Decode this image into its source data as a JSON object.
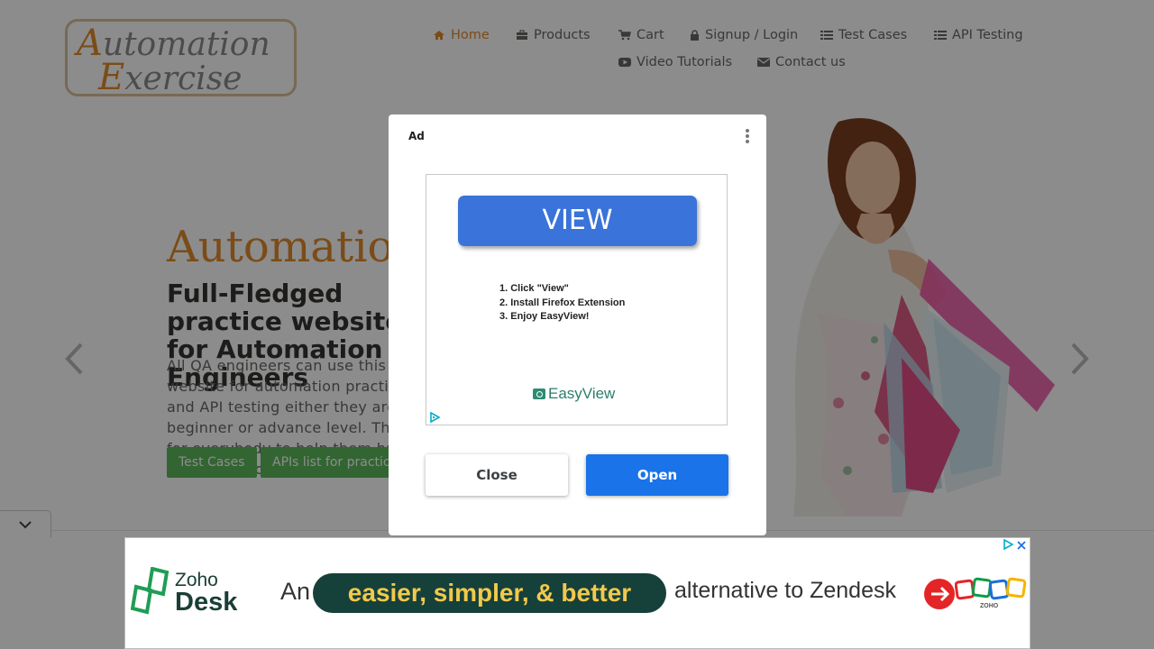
{
  "logo": {
    "line1_cap": "A",
    "line1_rest": "utomation",
    "line2_cap": "E",
    "line2_rest": "xercise"
  },
  "nav": [
    {
      "label": "Home",
      "icon": "home-icon",
      "active": true
    },
    {
      "label": "Products",
      "icon": "briefcase-icon"
    },
    {
      "label": "Cart",
      "icon": "cart-icon"
    },
    {
      "label": "Signup / Login",
      "icon": "lock-icon"
    },
    {
      "label": "Test Cases",
      "icon": "list-icon"
    },
    {
      "label": "API Testing",
      "icon": "list-icon"
    },
    {
      "label": "Video Tutorials",
      "icon": "youtube-icon"
    },
    {
      "label": "Contact us",
      "icon": "envelope-icon"
    }
  ],
  "hero": {
    "title": "Automation",
    "subtitle": "Full-Fledged practice website for Automation Engineers",
    "description": "All QA engineers can use this website for automation practice and API testing either they are at beginner or advance level. This is for everybody to help them brush up their automation skills.",
    "btn_test_cases": "Test Cases",
    "btn_apis": "APIs list for practice"
  },
  "ad_modal": {
    "ad_label": "Ad",
    "view_label": "VIEW",
    "steps": [
      "1. Click \"View\"",
      "2. Install Firefox Extension",
      "3. Enjoy EasyView!"
    ],
    "brand": "EasyView",
    "close_label": "Close",
    "open_label": "Open"
  },
  "banner": {
    "brand_line1": "Zoho",
    "brand_line2": "Desk",
    "tag_an": "An",
    "tag_highlight": "easier, simpler, & better",
    "tag_rest": "alternative to Zendesk",
    "zoho_small": "ZOHO"
  },
  "colors": {
    "accent": "#e08a2b",
    "green": "#5cb85c",
    "primary_blue": "#1a73e8"
  }
}
